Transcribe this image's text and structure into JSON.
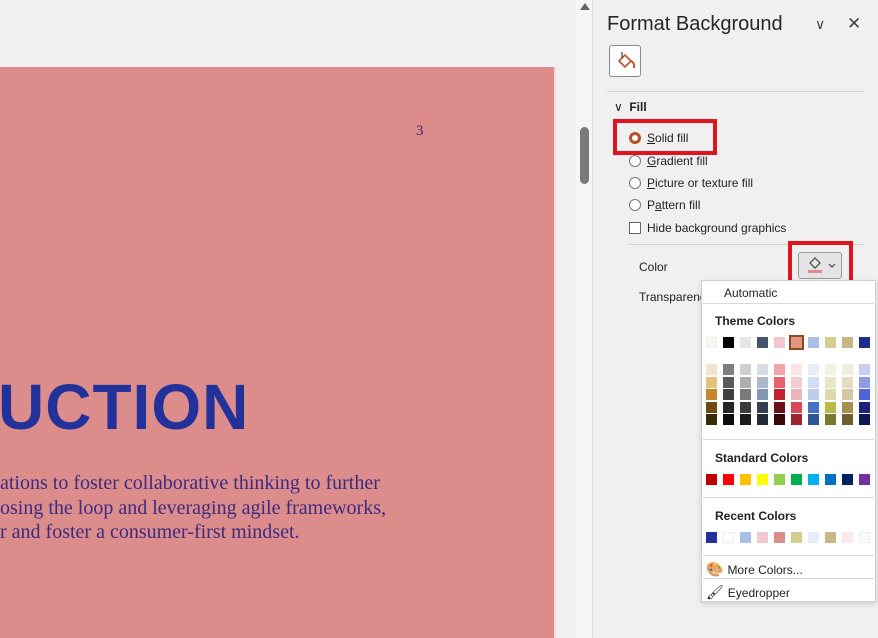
{
  "slide": {
    "page_number": "3",
    "title_fragment": "UCTION",
    "body_lines": [
      "ations to foster collaborative thinking to further",
      "osing the loop and leveraging agile frameworks,",
      "r and foster a consumer-first mindset."
    ],
    "background_color": "#dd8c8c",
    "title_color": "#22329a",
    "body_color": "#3a2b7f"
  },
  "pane": {
    "title": "Format Background",
    "options_icon": "chevron-down-icon",
    "close_icon": "close-icon",
    "tab_icon": "paint-bucket-icon",
    "section_label": "Fill",
    "fill_options": [
      {
        "label": "Solid fill",
        "access_key": "S",
        "selected": true
      },
      {
        "label": "Gradient fill",
        "access_key": "G",
        "selected": false
      },
      {
        "label": "Picture or texture fill",
        "access_key": "P",
        "selected": false
      },
      {
        "label": "Pattern fill",
        "access_key": "a",
        "selected": false
      }
    ],
    "hide_graphics_label": "Hide background graphics",
    "hide_graphics_checked": false,
    "color_label": "Color",
    "transparency_label": "Transparency"
  },
  "color_menu": {
    "automatic_label": "Automatic",
    "theme_colors_label": "Theme Colors",
    "theme_top_row": [
      "#f7f7f2",
      "#000000",
      "#e6e6e6",
      "#44546a",
      "#f2c9cf",
      "#e39580",
      "#a8bfe6",
      "#d3cd94",
      "#c8b888",
      "#1f2d8c"
    ],
    "theme_selected_index": 5,
    "theme_shades": [
      [
        "#f0e4cc",
        "#7f7f7f",
        "#d0d0d0",
        "#d6dbe4",
        "#f0a4aa",
        "#fbe4e6",
        "#e8eef9",
        "#f3f2e6",
        "#f0ece0",
        "#c8cdf2"
      ],
      [
        "#e6c07e",
        "#595959",
        "#aeaeae",
        "#adb8ca",
        "#e2646e",
        "#f3ccd2",
        "#d0ddf3",
        "#e8e6ca",
        "#e3dcc0",
        "#8d9be6"
      ],
      [
        "#c8862a",
        "#3f3f3f",
        "#7a7a7a",
        "#8496b0",
        "#c22030",
        "#ebb3bb",
        "#bacdeb",
        "#dcd9ae",
        "#d4c8a0",
        "#5064d8"
      ],
      [
        "#6e4a14",
        "#262626",
        "#3a3a3a",
        "#333f50",
        "#6e1018",
        "#d84a58",
        "#4472c4",
        "#b9ba4a",
        "#a89050",
        "#19247a"
      ],
      [
        "#3a2a0c",
        "#0d0d0d",
        "#1a1a1a",
        "#222a35",
        "#380808",
        "#a02430",
        "#2e5496",
        "#767a2e",
        "#6e5e30",
        "#101852"
      ]
    ],
    "standard_colors_label": "Standard Colors",
    "standard_colors": [
      "#c00000",
      "#ff0000",
      "#ffc000",
      "#ffff00",
      "#92d050",
      "#00b050",
      "#00b0f0",
      "#0070c0",
      "#002060",
      "#7030a0"
    ],
    "recent_colors_label": "Recent Colors",
    "recent_colors": [
      "#22329a",
      "#ffffff",
      "#a8bfe6",
      "#f2c9cf",
      "#dd8c8c",
      "#d3cd94",
      "#e8eef9",
      "#c8b888",
      "#fbe9ec",
      "#fafafa"
    ],
    "more_colors_label": "More Colors...",
    "eyedropper_label": "Eyedropper"
  },
  "accent": {
    "highlight_box": "#e0141e",
    "selected_radio": "#b5512b"
  }
}
